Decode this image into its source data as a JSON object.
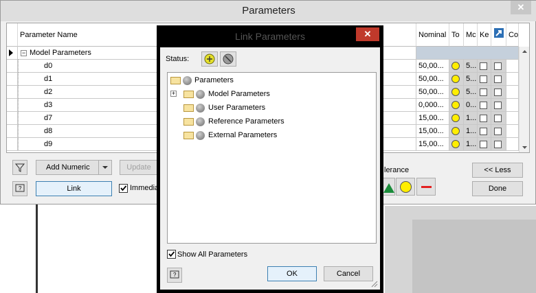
{
  "parameters_window": {
    "title": "Parameters",
    "close_glyph": "✕",
    "columns": [
      "Parameter Name",
      "Nominal '",
      "To",
      "Mc",
      "Ke",
      "Co"
    ],
    "group_row": "Model Parameters",
    "rows": [
      {
        "name": "d0",
        "nominal": "50,00...",
        "mc": "5..."
      },
      {
        "name": "d1",
        "nominal": "50,00...",
        "mc": "5..."
      },
      {
        "name": "d2",
        "nominal": "50,00...",
        "mc": "5..."
      },
      {
        "name": "d3",
        "nominal": "0,000...",
        "mc": "0..."
      },
      {
        "name": "d7",
        "nominal": "15,00...",
        "mc": "1..."
      },
      {
        "name": "d8",
        "nominal": "15,00...",
        "mc": "1..."
      },
      {
        "name": "d9",
        "nominal": "15,00...",
        "mc": "1..."
      }
    ],
    "buttons": {
      "add_numeric": "Add Numeric",
      "update": "Update",
      "link": "Link",
      "immediate": "Immedia",
      "less": "<< Less",
      "done": "Done"
    },
    "tolerance_label": "lerance",
    "filter_icon": "filter-icon",
    "help_icon": "help-icon"
  },
  "link_dialog": {
    "title": "Link Parameters",
    "close_glyph": "✕",
    "status_label": "Status:",
    "tree": [
      {
        "label": "Parameters"
      },
      {
        "label": "Model Parameters",
        "expander": "+"
      },
      {
        "label": "User Parameters"
      },
      {
        "label": "Reference Parameters"
      },
      {
        "label": "External Parameters"
      }
    ],
    "show_all_label": "Show All Parameters",
    "ok": "OK",
    "cancel": "Cancel"
  }
}
